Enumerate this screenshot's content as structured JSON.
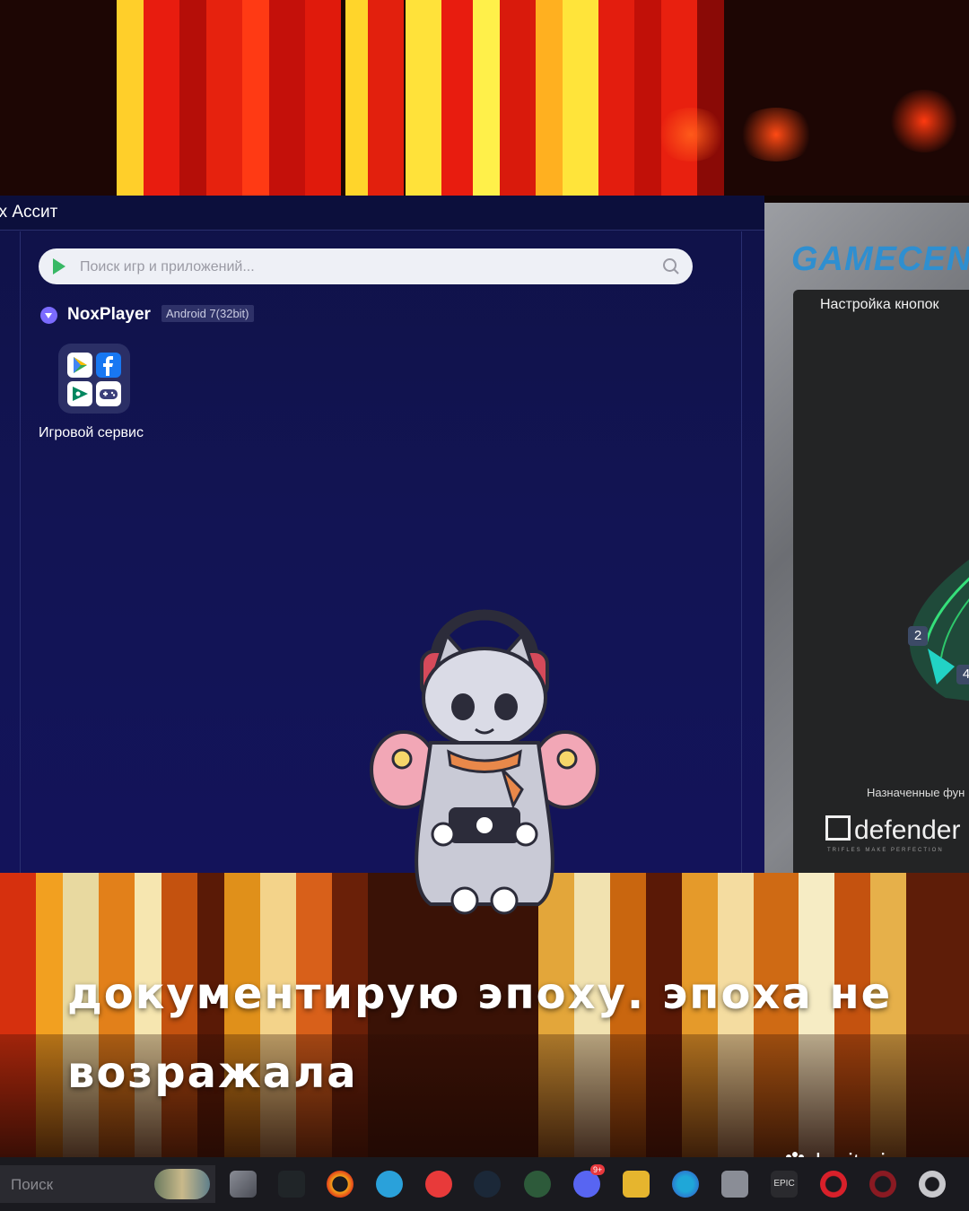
{
  "nox": {
    "window_title": "ox Ассит",
    "search_placeholder": "Поиск игр и приложений...",
    "player_name": "NoxPlayer",
    "android_version": "Android 7(32bit)",
    "app_label": "Игровой сервис"
  },
  "gamecenter": {
    "logo": "GAMECEN",
    "heading": "Настройка кнопок",
    "button_2": "2",
    "button_4": "4",
    "assigned_label": "Назначенные фун",
    "brand": "defender",
    "brand_tagline": "TRIFLES MAKE PERFECTION"
  },
  "caption": {
    "line1": "документирую эпоху. эпоха не",
    "line2": "возражала"
  },
  "watermark": "keriteri",
  "taskbar": {
    "search_placeholder": "Поиск",
    "discord_badge": "9+",
    "epic_label": "EPIC"
  },
  "colors": {
    "nox_bg": "#121454",
    "accent_blue": "#2f8fd0",
    "fire_red": "#d81b10",
    "fire_yellow": "#ffd22a"
  }
}
